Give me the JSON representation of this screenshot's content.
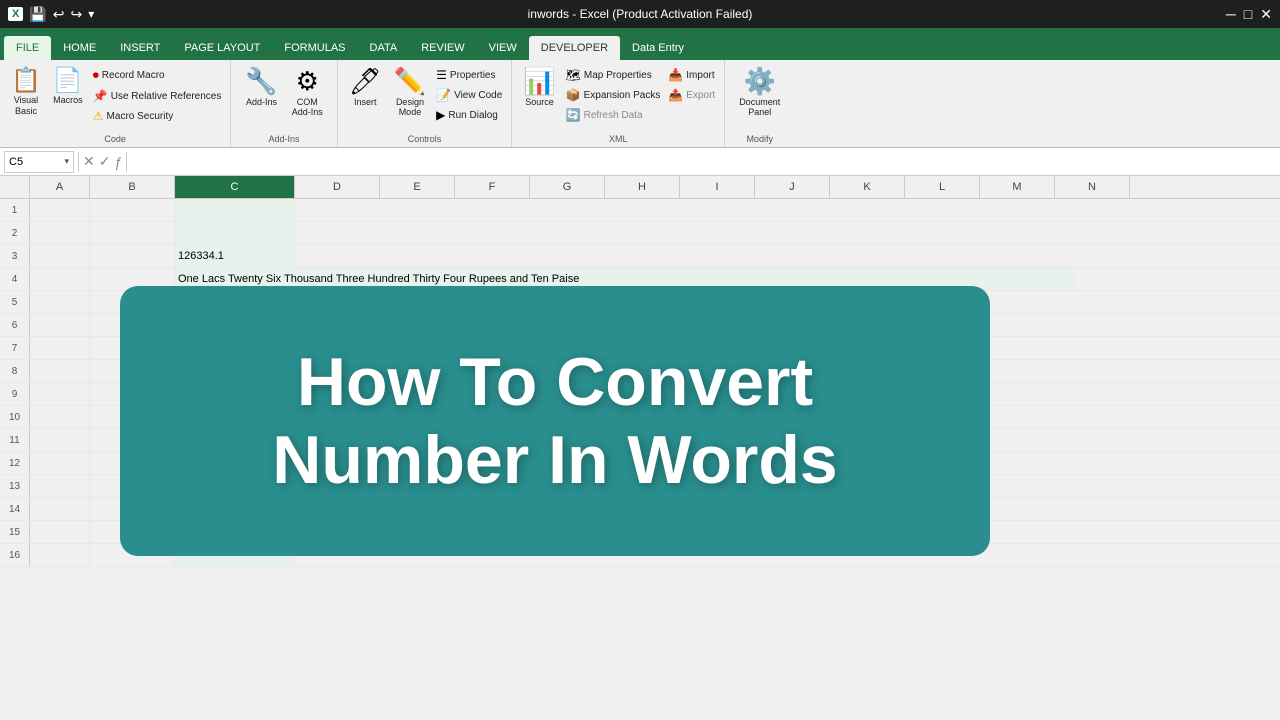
{
  "titlebar": {
    "title": "inwords - Excel (Product Activation Failed)"
  },
  "quickaccess": {
    "logo": "X",
    "save": "💾",
    "undo": "↩",
    "redo": "↪"
  },
  "tabs": [
    {
      "id": "file",
      "label": "FILE"
    },
    {
      "id": "home",
      "label": "HOME"
    },
    {
      "id": "insert",
      "label": "INSERT"
    },
    {
      "id": "pagelayout",
      "label": "PAGE LAYOUT"
    },
    {
      "id": "formulas",
      "label": "FORMULAS"
    },
    {
      "id": "data",
      "label": "DATA"
    },
    {
      "id": "review",
      "label": "REVIEW"
    },
    {
      "id": "view",
      "label": "VIEW"
    },
    {
      "id": "developer",
      "label": "DEVELOPER"
    },
    {
      "id": "dataentry",
      "label": "Data Entry"
    }
  ],
  "ribbon": {
    "groups": [
      {
        "id": "code",
        "label": "Code",
        "items": [
          {
            "id": "visual-basic",
            "type": "large",
            "icon": "📋",
            "label": "Visual\nBasic"
          },
          {
            "id": "macros",
            "type": "large",
            "icon": "📄",
            "label": "Macros"
          },
          {
            "id": "record-macro",
            "type": "small",
            "icon": "⏺",
            "label": "Record Macro"
          },
          {
            "id": "use-relative",
            "type": "small",
            "icon": "📌",
            "label": "Use Relative References"
          },
          {
            "id": "macro-security",
            "type": "small",
            "icon": "⚠",
            "label": "Macro Security",
            "warn": true
          }
        ]
      },
      {
        "id": "addins",
        "label": "Add-Ins",
        "items": [
          {
            "id": "add-ins",
            "type": "large",
            "icon": "🔧",
            "label": "Add-Ins"
          },
          {
            "id": "com-addins",
            "type": "large",
            "icon": "⚙",
            "label": "COM\nAdd-Ins"
          }
        ]
      },
      {
        "id": "controls",
        "label": "Controls",
        "items": [
          {
            "id": "insert-ctrl",
            "type": "large",
            "icon": "🖊",
            "label": "Insert"
          },
          {
            "id": "design-mode",
            "type": "large",
            "icon": "✏",
            "label": "Design\nMode"
          },
          {
            "id": "properties",
            "type": "small",
            "icon": "☰",
            "label": "Properties"
          },
          {
            "id": "view-code",
            "type": "small",
            "icon": "📝",
            "label": "View Code"
          },
          {
            "id": "run-dialog",
            "type": "small",
            "icon": "▶",
            "label": "Run Dialog"
          }
        ]
      },
      {
        "id": "xml",
        "label": "XML",
        "items": [
          {
            "id": "source",
            "type": "large",
            "icon": "📊",
            "label": "Source"
          },
          {
            "id": "map-properties",
            "type": "small",
            "icon": "🗺",
            "label": "Map Properties"
          },
          {
            "id": "expansion-packs",
            "type": "small",
            "icon": "📦",
            "label": "Expansion Packs"
          },
          {
            "id": "refresh-data",
            "type": "small",
            "icon": "🔄",
            "label": "Refresh Data"
          },
          {
            "id": "import",
            "type": "small",
            "icon": "📥",
            "label": "Import"
          },
          {
            "id": "export",
            "type": "small",
            "icon": "📤",
            "label": "Export"
          }
        ]
      },
      {
        "id": "modify",
        "label": "Modify",
        "items": [
          {
            "id": "document-panel",
            "type": "large",
            "icon": "⚙",
            "label": "Document\nPanel"
          }
        ]
      }
    ]
  },
  "formulabar": {
    "cellref": "C5",
    "value": ""
  },
  "columns": [
    "A",
    "B",
    "C",
    "D",
    "E",
    "F",
    "G",
    "H",
    "I",
    "J",
    "K",
    "L",
    "M",
    "N"
  ],
  "rows": [
    {
      "num": 1,
      "cells": [
        "",
        "",
        "",
        "",
        "",
        "",
        "",
        "",
        "",
        "",
        "",
        "",
        "",
        ""
      ]
    },
    {
      "num": 2,
      "cells": [
        "",
        "",
        "",
        "",
        "",
        "",
        "",
        "",
        "",
        "",
        "",
        "",
        "",
        ""
      ]
    },
    {
      "num": 3,
      "cells": [
        "",
        "",
        "126334.1",
        "",
        "",
        "",
        "",
        "",
        "",
        "",
        "",
        "",
        "",
        ""
      ]
    },
    {
      "num": 4,
      "cells": [
        "",
        "",
        "One Lacs Twenty Six Thousand Three Hundred Thirty Four Rupees and Ten Paise",
        "",
        "",
        "",
        "",
        "",
        "",
        "",
        "",
        "",
        "",
        ""
      ]
    },
    {
      "num": 5,
      "cells": [
        "",
        "",
        "",
        "",
        "",
        "",
        "",
        "",
        "",
        "",
        "",
        "",
        "",
        ""
      ]
    },
    {
      "num": 6,
      "cells": [
        "",
        "",
        "",
        "",
        "",
        "",
        "",
        "",
        "",
        "",
        "",
        "",
        "",
        ""
      ]
    },
    {
      "num": 7,
      "cells": [
        "",
        "",
        "",
        "",
        "",
        "",
        "",
        "",
        "",
        "",
        "",
        "",
        "",
        ""
      ]
    },
    {
      "num": 8,
      "cells": [
        "",
        "",
        "",
        "",
        "",
        "",
        "",
        "",
        "",
        "",
        "",
        "",
        "",
        ""
      ]
    },
    {
      "num": 9,
      "cells": [
        "",
        "",
        "",
        "",
        "",
        "",
        "",
        "",
        "",
        "",
        "",
        "",
        "",
        ""
      ]
    },
    {
      "num": 10,
      "cells": [
        "",
        "",
        "",
        "",
        "",
        "",
        "",
        "",
        "",
        "",
        "",
        "",
        "",
        ""
      ]
    },
    {
      "num": 11,
      "cells": [
        "",
        "",
        "",
        "",
        "",
        "",
        "",
        "",
        "",
        "",
        "",
        "",
        "",
        ""
      ]
    },
    {
      "num": 12,
      "cells": [
        "",
        "",
        "",
        "",
        "",
        "",
        "",
        "",
        "",
        "",
        "",
        "",
        "",
        ""
      ]
    },
    {
      "num": 13,
      "cells": [
        "",
        "",
        "",
        "",
        "",
        "",
        "",
        "",
        "",
        "",
        "",
        "",
        "",
        ""
      ]
    },
    {
      "num": 14,
      "cells": [
        "",
        "",
        "",
        "",
        "",
        "",
        "",
        "",
        "",
        "",
        "",
        "",
        "",
        ""
      ]
    },
    {
      "num": 15,
      "cells": [
        "",
        "",
        "",
        "",
        "",
        "",
        "",
        "",
        "",
        "",
        "",
        "",
        "",
        ""
      ]
    },
    {
      "num": 16,
      "cells": [
        "",
        "",
        "",
        "",
        "",
        "",
        "",
        "",
        "",
        "",
        "",
        "",
        "",
        ""
      ]
    }
  ],
  "overlay": {
    "line1": "How To Convert",
    "line2": "Number In Words"
  }
}
